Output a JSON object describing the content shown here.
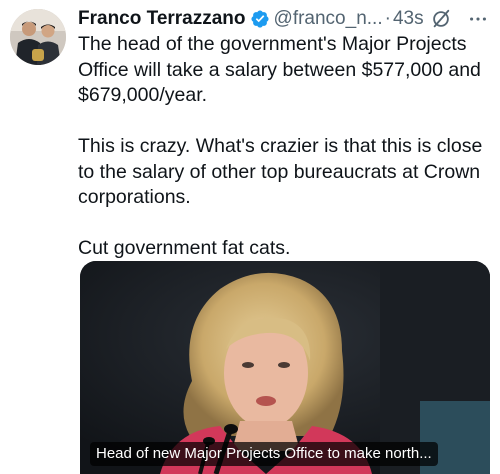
{
  "tweet": {
    "author_name": "Franco Terrazzano",
    "handle": "@franco_n...",
    "separator": "·",
    "time": "43s",
    "paragraphs": [
      "The head of the government's Major Projects Office will take a salary between $577,000 and $679,000/year.",
      "This is crazy. What's crazier is that this is close to the salary of other top bureaucrats at Crown corporations.",
      "Cut government fat cats."
    ],
    "media": {
      "caption": "Head of new Major Projects Office to make north..."
    }
  },
  "icons": {
    "verified": "verified-badge-icon",
    "grok": "grok-icon",
    "more": "more-options-icon"
  },
  "colors": {
    "text": "#0f1419",
    "secondary": "#536471",
    "verified_blue": "#1d9bf0"
  }
}
